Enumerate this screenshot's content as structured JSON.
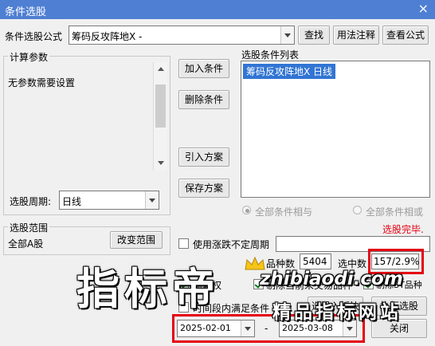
{
  "window": {
    "title": "条件选股",
    "close_glyph": "×"
  },
  "formula": {
    "label": "条件选股公式",
    "value": "筹码反攻阵地X  -",
    "find_btn": "查找",
    "usage_btn": "用法注释",
    "view_btn": "查看公式"
  },
  "params": {
    "legend": "计算参数",
    "text": "无参数需要设置"
  },
  "period": {
    "label": "选股周期:",
    "value": "日线"
  },
  "actions": {
    "add": "加入条件",
    "delete": "删除条件",
    "import": "引入方案",
    "save": "保存方案"
  },
  "condlist": {
    "label": "选股条件列表",
    "items": [
      "筹码反攻阵地X  日线"
    ]
  },
  "logic": {
    "and_label": "全部条件相与",
    "or_label": "全部条件相或"
  },
  "status": {
    "done": "选股完毕.",
    "done_color": "#e60012"
  },
  "range": {
    "legend": "选股范围",
    "value": "全部A股",
    "change_btn": "改变范围"
  },
  "nonfixed": {
    "label": "使用涨跌不定周期"
  },
  "stats": {
    "count_label": "品种数",
    "count": "5404",
    "selected_label": "选中数",
    "selected": "157/2.9%"
  },
  "options": {
    "prefuq": "前复权",
    "block": "板块",
    "exclude": "剔除当前未交易品种",
    "exclude_st": "剔除ST品种",
    "time_label": "时间段内满足条件",
    "block_btn": "选股入板块",
    "exec_btn": "执行选股",
    "close_btn": "关闭"
  },
  "dates": {
    "start": "2025-02-01",
    "sep": "-",
    "end": "2025-03-08"
  },
  "watermark": {
    "big": "指标帝",
    "site": "zhibiaodi.com",
    "cn": "精品指标网站"
  }
}
